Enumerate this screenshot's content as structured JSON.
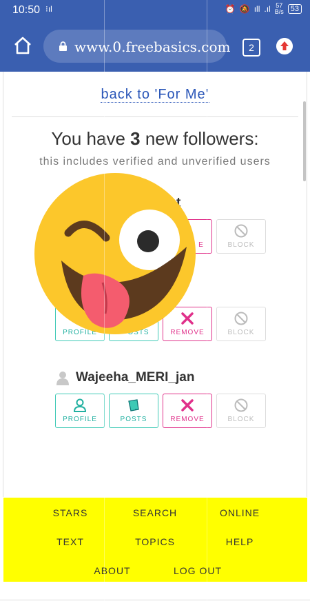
{
  "status": {
    "time": "10:50",
    "netspeed_value": "57",
    "netspeed_unit": "B/s",
    "battery": "53"
  },
  "browser": {
    "url": "www.0.freebasics.com",
    "tab_count": "2"
  },
  "page": {
    "back_link": "back to 'For Me'",
    "headline_pre": "You have ",
    "headline_count": "3",
    "headline_post": " new followers:",
    "subline": "this includes verified and unverified users",
    "followers": [
      {
        "name": "t"
      },
      {
        "name": ""
      },
      {
        "name": "Wajeeha_MERI_jan"
      }
    ],
    "buttons": {
      "profile": "PROFILE",
      "posts": "POSTS",
      "remove": "REMOVE",
      "block": "BLOCK"
    },
    "partial_labels": {
      "row1_remove": "E",
      "row2_profile": "PROFILE",
      "row2_posts": "OSTS"
    }
  },
  "footer": {
    "stars": "STARS",
    "search": "SEARCH",
    "online": "ONLINE",
    "text": "TEXT",
    "topics": "TOPICS",
    "help": "HELP",
    "about": "ABOUT",
    "logout": "LOG OUT"
  },
  "colors": {
    "header": "#3a5fb0",
    "footer": "#ffff00",
    "teal": "#3dc9b5",
    "pink": "#e0308a",
    "link": "#2a56b8"
  }
}
